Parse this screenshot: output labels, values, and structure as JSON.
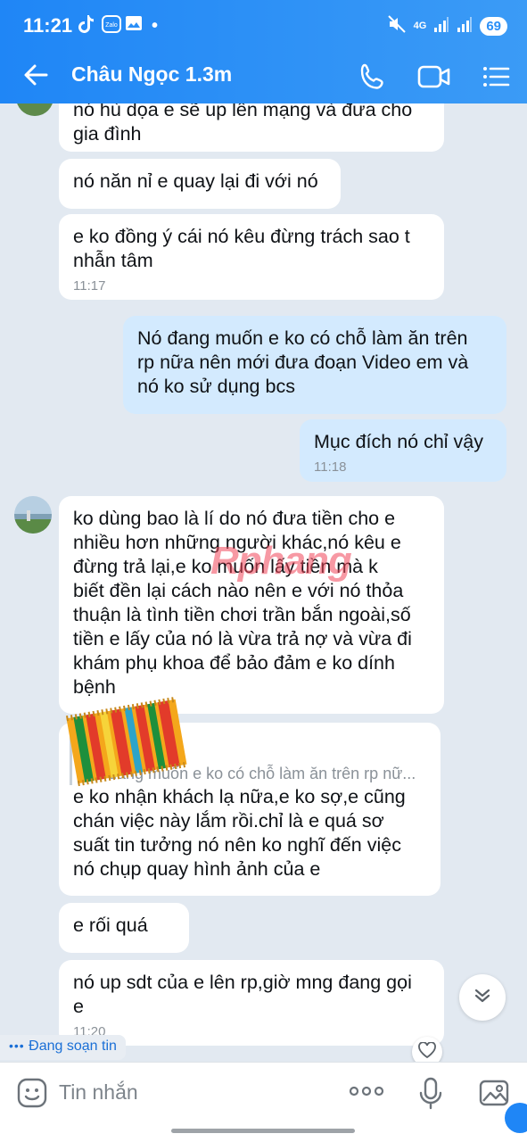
{
  "status_bar": {
    "time": "11:21",
    "net": "4G",
    "battery": "69"
  },
  "header": {
    "title": "Châu Ngọc 1.3m"
  },
  "messages": [
    {
      "text": "nó hù dọa e sẽ up lên mạng và đưa cho gia đình",
      "line1": "nó hù dọa e sẽ up lên mạng và đưa cho",
      "line2": "gia đình"
    },
    {
      "text": "nó năn nỉ e quay lại đi với nó"
    },
    {
      "line1": "e ko đồng ý cái nó kêu đừng trách sao t",
      "line2": "nhẫn tâm",
      "time": "11:17"
    },
    {
      "line1": "Nó đang muốn e ko có chỗ làm ăn trên",
      "line2": "rp nữa nên mới đưa đoạn Video em và",
      "line3": "nó ko sử dụng bcs"
    },
    {
      "text": "Mục đích nó chỉ vậy",
      "time": "11:18"
    },
    {
      "lines": [
        "ko dùng bao là lí do nó đưa tiền cho e",
        "nhiều hơn những người khác,nó kêu e",
        "đừng trả lại,e ko muốn lấy tiền mà k",
        "biết đền lại cách nào nên e với nó thỏa",
        "thuận là tình tiền chơi trần bắn ngoài,số",
        "tiền e lấy của nó là vừa trả nợ và vừa đi",
        "khám phụ khoa để bảo đảm e ko dính",
        "bệnh"
      ]
    },
    {
      "quote": "Nó đang muốn e ko có chỗ làm ăn trên rp nữ...",
      "lines": [
        "e ko nhận khách lạ nữa,e ko sợ,e cũng",
        "chán việc này lắm rồi.chỉ là e quá sơ",
        "suất tin tưởng nó nên ko nghĩ đến việc",
        "nó chụp quay hình ảnh của e"
      ]
    },
    {
      "text": "e rối quá"
    },
    {
      "line1": "nó up sdt của e lên rp,giờ mng đang gọi",
      "line2": "e",
      "time": "11:20"
    }
  ],
  "watermark": "Rphang",
  "typing_indicator": "Đang soạn tin",
  "input": {
    "placeholder": "Tin nhắn"
  },
  "colors": {
    "header_blue": "#1f86f6",
    "sent_bubble": "#d3eafe",
    "received_bubble": "#ffffff",
    "chat_bg": "#e2e9f1"
  }
}
